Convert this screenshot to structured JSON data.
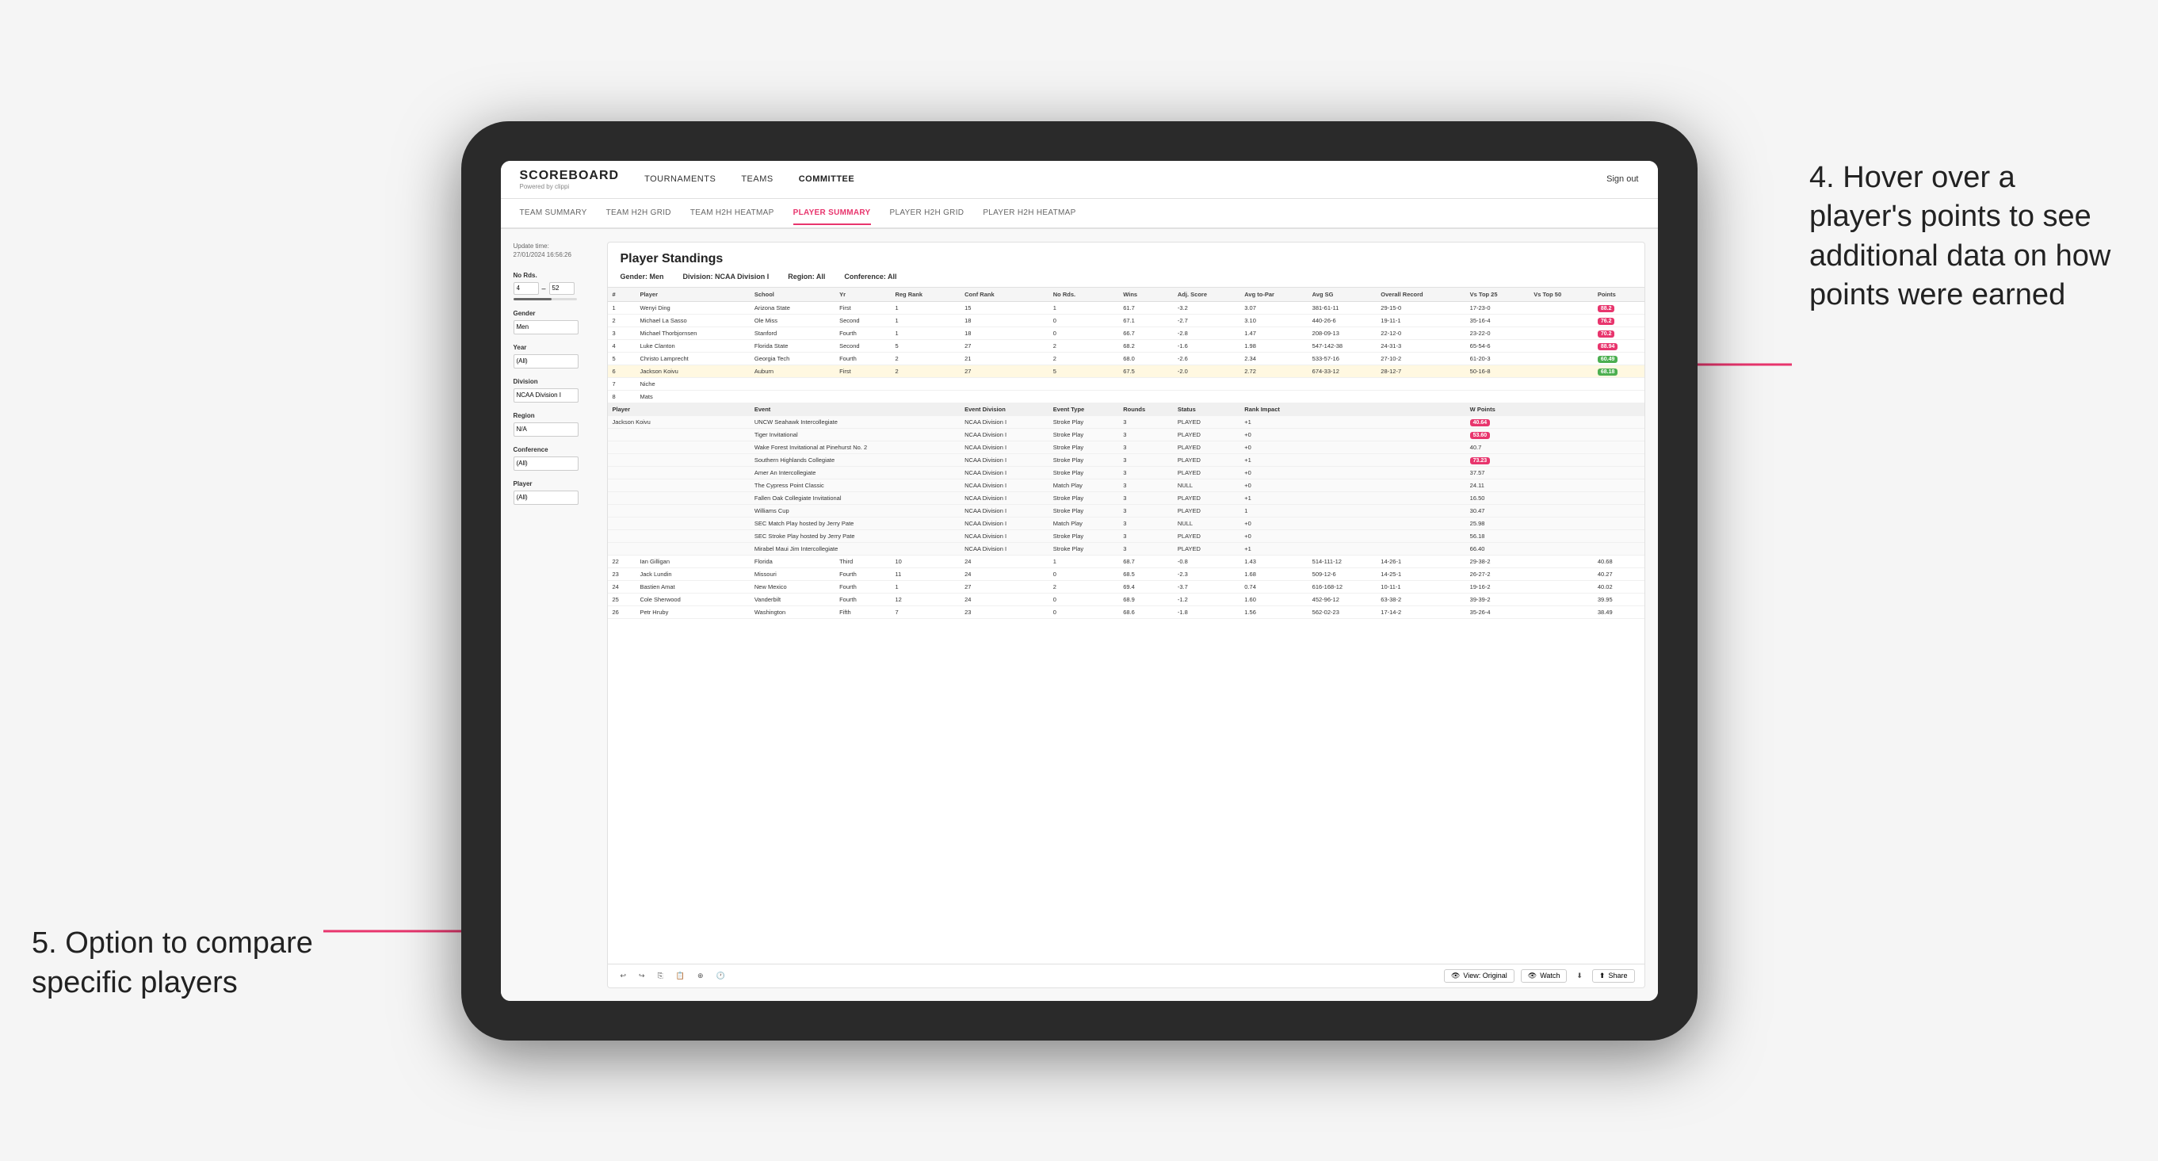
{
  "app": {
    "logo": "SCOREBOARD",
    "logo_sub": "Powered by clippi",
    "sign_out": "Sign out"
  },
  "nav": {
    "items": [
      {
        "label": "TOURNAMENTS",
        "active": false
      },
      {
        "label": "TEAMS",
        "active": false
      },
      {
        "label": "COMMITTEE",
        "active": true
      }
    ]
  },
  "sub_nav": {
    "items": [
      {
        "label": "TEAM SUMMARY",
        "active": false
      },
      {
        "label": "TEAM H2H GRID",
        "active": false
      },
      {
        "label": "TEAM H2H HEATMAP",
        "active": false
      },
      {
        "label": "PLAYER SUMMARY",
        "active": true
      },
      {
        "label": "PLAYER H2H GRID",
        "active": false
      },
      {
        "label": "PLAYER H2H HEATMAP",
        "active": false
      }
    ]
  },
  "filters": {
    "update_time_label": "Update time:",
    "update_time": "27/01/2024 16:56:26",
    "no_rds_label": "No Rds.",
    "no_rds_min": "4",
    "no_rds_max": "52",
    "gender_label": "Gender",
    "gender_value": "Men",
    "year_label": "Year",
    "year_value": "(All)",
    "division_label": "Division",
    "division_value": "NCAA Division I",
    "region_label": "Region",
    "region_value": "N/A",
    "conference_label": "Conference",
    "conference_value": "(All)",
    "player_label": "Player",
    "player_value": "(All)"
  },
  "table": {
    "title": "Player Standings",
    "filter_gender": "Gender: Men",
    "filter_division": "Division: NCAA Division I",
    "filter_region": "Region: All",
    "filter_conference": "Conference: All",
    "columns": [
      "#",
      "Player",
      "School",
      "Yr",
      "Reg Rank",
      "Conf Rank",
      "No Rds.",
      "Wins",
      "Adj. Score",
      "Avg to-Par",
      "Avg SG",
      "Overall Record",
      "Vs Top 25",
      "Vs Top 50",
      "Points"
    ],
    "rows": [
      {
        "num": "1",
        "player": "Wenyi Ding",
        "school": "Arizona State",
        "yr": "First",
        "reg_rank": "1",
        "conf_rank": "15",
        "no_rds": "1",
        "wins": "61.7",
        "adj_score": "-3.2",
        "avg_to_par": "3.07",
        "avg_sg": "381-61-11",
        "overall": "29-15-0",
        "vs_top25": "17-23-0",
        "vs_top50": "",
        "points": "88.2",
        "points_class": "red"
      },
      {
        "num": "2",
        "player": "Michael La Sasso",
        "school": "Ole Miss",
        "yr": "Second",
        "reg_rank": "1",
        "conf_rank": "18",
        "no_rds": "0",
        "wins": "67.1",
        "adj_score": "-2.7",
        "avg_to_par": "3.10",
        "avg_sg": "440-26-6",
        "overall": "19-11-1",
        "vs_top25": "35-16-4",
        "vs_top50": "",
        "points": "76.2",
        "points_class": "red"
      },
      {
        "num": "3",
        "player": "Michael Thorbjornsen",
        "school": "Stanford",
        "yr": "Fourth",
        "reg_rank": "1",
        "conf_rank": "18",
        "no_rds": "0",
        "wins": "66.7",
        "adj_score": "-2.8",
        "avg_to_par": "1.47",
        "avg_sg": "208-09-13",
        "overall": "22-12-0",
        "vs_top25": "23-22-0",
        "vs_top50": "",
        "points": "70.2",
        "points_class": "red"
      },
      {
        "num": "4",
        "player": "Luke Clanton",
        "school": "Florida State",
        "yr": "Second",
        "reg_rank": "5",
        "conf_rank": "27",
        "no_rds": "2",
        "wins": "68.2",
        "adj_score": "-1.6",
        "avg_to_par": "1.98",
        "avg_sg": "547-142-38",
        "overall": "24-31-3",
        "vs_top25": "65-54-6",
        "vs_top50": "",
        "points": "88.94",
        "points_class": "red"
      },
      {
        "num": "5",
        "player": "Christo Lamprecht",
        "school": "Georgia Tech",
        "yr": "Fourth",
        "reg_rank": "2",
        "conf_rank": "21",
        "no_rds": "2",
        "wins": "68.0",
        "adj_score": "-2.6",
        "avg_to_par": "2.34",
        "avg_sg": "533-57-16",
        "overall": "27-10-2",
        "vs_top25": "61-20-3",
        "vs_top50": "",
        "points": "60.49",
        "points_class": "green"
      },
      {
        "num": "6",
        "player": "Jackson Koivu",
        "school": "Auburn",
        "yr": "First",
        "reg_rank": "2",
        "conf_rank": "27",
        "no_rds": "5",
        "wins": "67.5",
        "adj_score": "-2.0",
        "avg_to_par": "2.72",
        "avg_sg": "674-33-12",
        "overall": "28-12-7",
        "vs_top25": "50-16-8",
        "vs_top50": "",
        "points": "68.18",
        "points_class": "green"
      }
    ],
    "popup_header": [
      "Player",
      "Event",
      "Event Division",
      "Event Type",
      "Rounds",
      "Status",
      "Rank Impact",
      "W Points"
    ],
    "popup_rows": [
      {
        "player": "Jackson Koivu",
        "event": "UNCW Seahawk Intercollegiate",
        "division": "NCAA Division I",
        "type": "Stroke Play",
        "rounds": "3",
        "status": "PLAYED",
        "rank_impact": "+1",
        "w_points": "40.64",
        "highlight": true
      },
      {
        "player": "",
        "event": "Tiger Invitational",
        "division": "NCAA Division I",
        "type": "Stroke Play",
        "rounds": "3",
        "status": "PLAYED",
        "rank_impact": "+0",
        "w_points": "53.60"
      },
      {
        "player": "",
        "event": "Wake Forest Invitational at Pinehurst No. 2",
        "division": "NCAA Division I",
        "type": "Stroke Play",
        "rounds": "3",
        "status": "PLAYED",
        "rank_impact": "+0",
        "w_points": "40.7"
      },
      {
        "player": "",
        "event": "Southern Highlands Collegiate",
        "division": "NCAA Division I",
        "type": "Stroke Play",
        "rounds": "3",
        "status": "PLAYED",
        "rank_impact": "+1",
        "w_points": "73.23"
      },
      {
        "player": "",
        "event": "Amer An Intercollegiate",
        "division": "NCAA Division I",
        "type": "Stroke Play",
        "rounds": "3",
        "status": "PLAYED",
        "rank_impact": "+0",
        "w_points": "37.57"
      },
      {
        "player": "",
        "event": "The Cypress Point Classic",
        "division": "NCAA Division I",
        "type": "Match Play",
        "rounds": "3",
        "status": "NULL",
        "rank_impact": "+0",
        "w_points": "24.11"
      },
      {
        "player": "",
        "event": "Fallen Oak Collegiate Invitational",
        "division": "NCAA Division I",
        "type": "Stroke Play",
        "rounds": "3",
        "status": "PLAYED",
        "rank_impact": "+1",
        "w_points": "16.50"
      },
      {
        "player": "",
        "event": "Williams Cup",
        "division": "NCAA Division I",
        "type": "Stroke Play",
        "rounds": "3",
        "status": "PLAYED",
        "rank_impact": "1",
        "w_points": "30.47"
      },
      {
        "player": "",
        "event": "SEC Match Play hosted by Jerry Pate",
        "division": "NCAA Division I",
        "type": "Match Play",
        "rounds": "3",
        "status": "NULL",
        "rank_impact": "+0",
        "w_points": "25.98"
      },
      {
        "player": "",
        "event": "SEC Stroke Play hosted by Jerry Pate",
        "division": "NCAA Division I",
        "type": "Stroke Play",
        "rounds": "3",
        "status": "PLAYED",
        "rank_impact": "+0",
        "w_points": "56.18"
      },
      {
        "player": "",
        "event": "Mirabel Maui Jim Intercollegiate",
        "division": "NCAA Division I",
        "type": "Stroke Play",
        "rounds": "3",
        "status": "PLAYED",
        "rank_impact": "+1",
        "w_points": "66.40"
      }
    ],
    "extra_rows": [
      {
        "num": "22",
        "player": "Ian Gilligan",
        "school": "Florida",
        "yr": "Third",
        "reg_rank": "10",
        "conf_rank": "24",
        "no_rds": "1",
        "wins": "68.7",
        "adj_score": "-0.8",
        "avg_to_par": "1.43",
        "avg_sg": "514-111-12",
        "overall": "14-26-1",
        "vs_top25": "29-38-2",
        "vs_top50": "",
        "points": "40.68"
      },
      {
        "num": "23",
        "player": "Jack Lundin",
        "school": "Missouri",
        "yr": "Fourth",
        "reg_rank": "11",
        "conf_rank": "24",
        "no_rds": "0",
        "wins": "68.5",
        "adj_score": "-2.3",
        "avg_to_par": "1.68",
        "avg_sg": "509-12-6",
        "overall": "14-25-1",
        "vs_top25": "26-27-2",
        "vs_top50": "",
        "points": "40.27"
      },
      {
        "num": "24",
        "player": "Bastien Amat",
        "school": "New Mexico",
        "yr": "Fourth",
        "reg_rank": "1",
        "conf_rank": "27",
        "no_rds": "2",
        "wins": "69.4",
        "adj_score": "-3.7",
        "avg_to_par": "0.74",
        "avg_sg": "616-168-12",
        "overall": "10-11-1",
        "vs_top25": "19-16-2",
        "vs_top50": "",
        "points": "40.02"
      },
      {
        "num": "25",
        "player": "Cole Sherwood",
        "school": "Vanderbilt",
        "yr": "Fourth",
        "reg_rank": "12",
        "conf_rank": "24",
        "no_rds": "0",
        "wins": "68.9",
        "adj_score": "-1.2",
        "avg_to_par": "1.60",
        "avg_sg": "452-96-12",
        "overall": "63-38-2",
        "vs_top25": "39-39-2",
        "vs_top50": "",
        "points": "39.95"
      },
      {
        "num": "26",
        "player": "Petr Hruby",
        "school": "Washington",
        "yr": "Fifth",
        "reg_rank": "7",
        "conf_rank": "23",
        "no_rds": "0",
        "wins": "68.6",
        "adj_score": "-1.8",
        "avg_to_par": "1.56",
        "avg_sg": "562-02-23",
        "overall": "17-14-2",
        "vs_top25": "35-26-4",
        "vs_top50": "",
        "points": "38.49"
      }
    ]
  },
  "toolbar": {
    "view_label": "View: Original",
    "watch_label": "Watch",
    "share_label": "Share"
  },
  "annotations": {
    "right_text": "4. Hover over a player's points to see additional data on how points were earned",
    "left_text": "5. Option to compare specific players"
  }
}
